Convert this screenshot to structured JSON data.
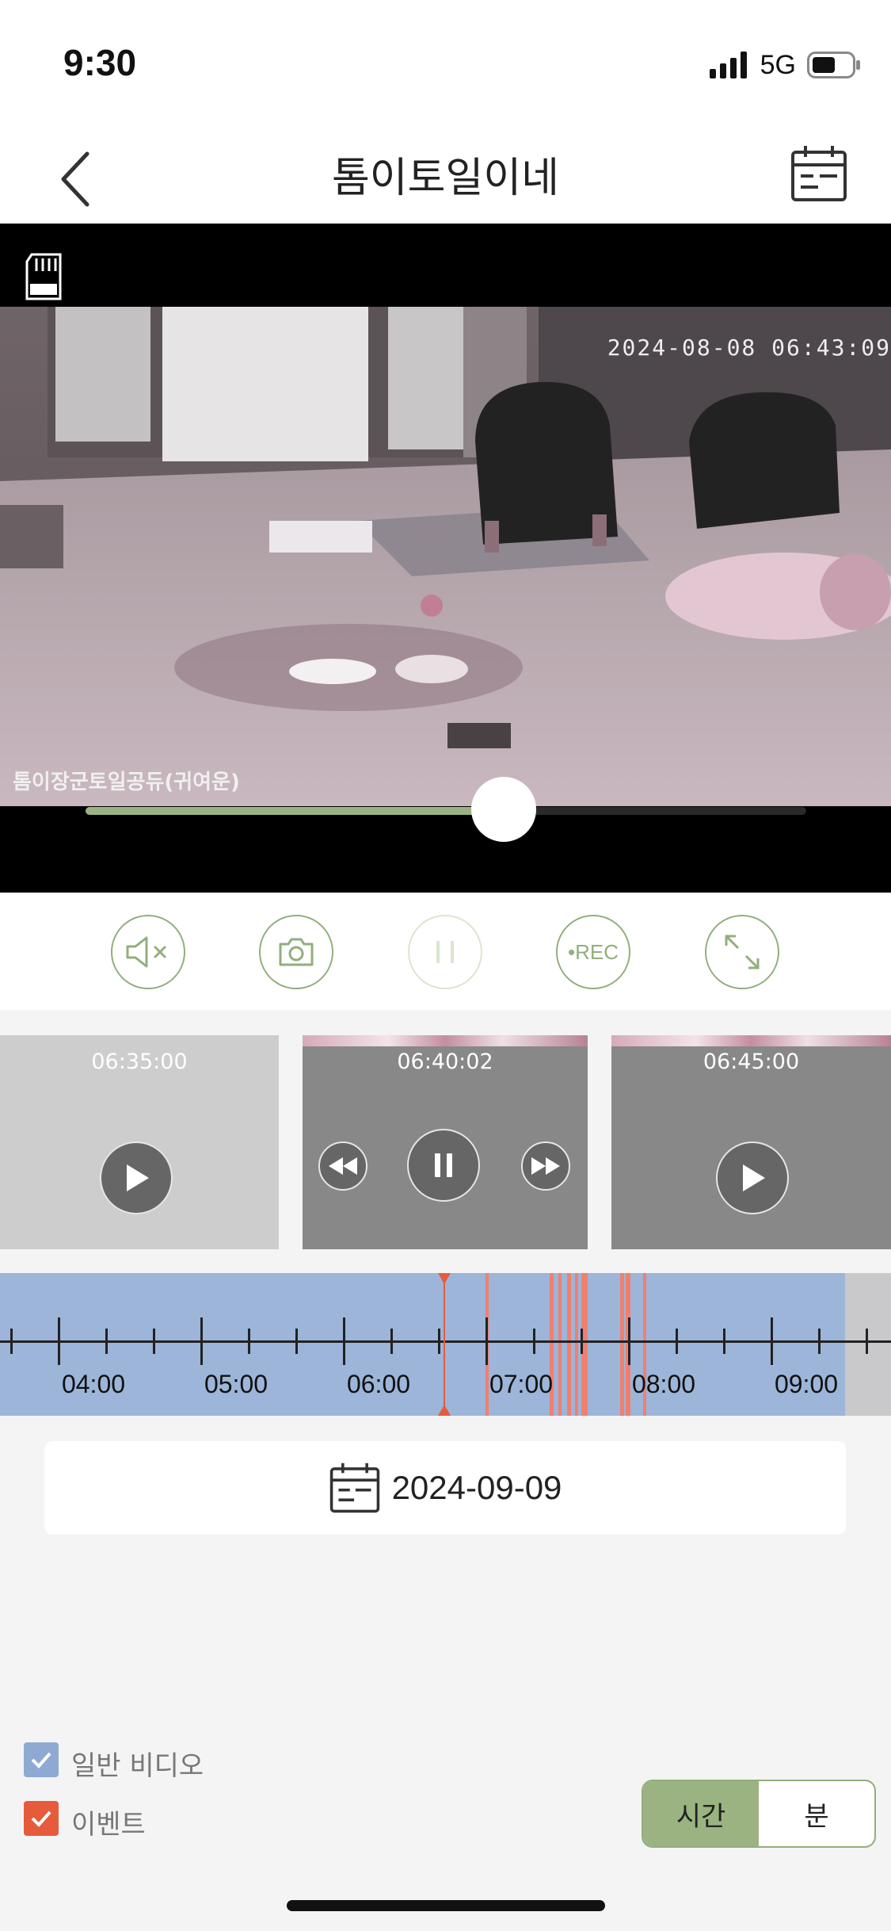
{
  "status_bar": {
    "time": "9:30",
    "network": "5G"
  },
  "nav": {
    "title": "톰이토일이네"
  },
  "video": {
    "timestamp": "2024-08-08  06:43:09",
    "camera_label": "톰이장군토일공듀(귀여운)",
    "progress": 0.58
  },
  "controls": {
    "rec_label": "•REC"
  },
  "clips": [
    {
      "time": "06:35:00"
    },
    {
      "time": "06:40:02"
    },
    {
      "time": "06:45:00"
    }
  ],
  "timeline": {
    "labels": [
      "04:00",
      "05:00",
      "06:00",
      "07:00",
      "08:00",
      "09:00"
    ]
  },
  "date_picker": {
    "value": "2024-09-09"
  },
  "legend": {
    "normal": "일반 비디오",
    "event": "이벤트"
  },
  "toggle": {
    "hour": "시간",
    "minute": "분"
  },
  "colors": {
    "accent": "#93ae7d",
    "timeline_normal": "#9cb5d8",
    "timeline_event": "#f07f70",
    "legend_normal": "#8eaad3",
    "legend_event": "#e55b3c"
  }
}
